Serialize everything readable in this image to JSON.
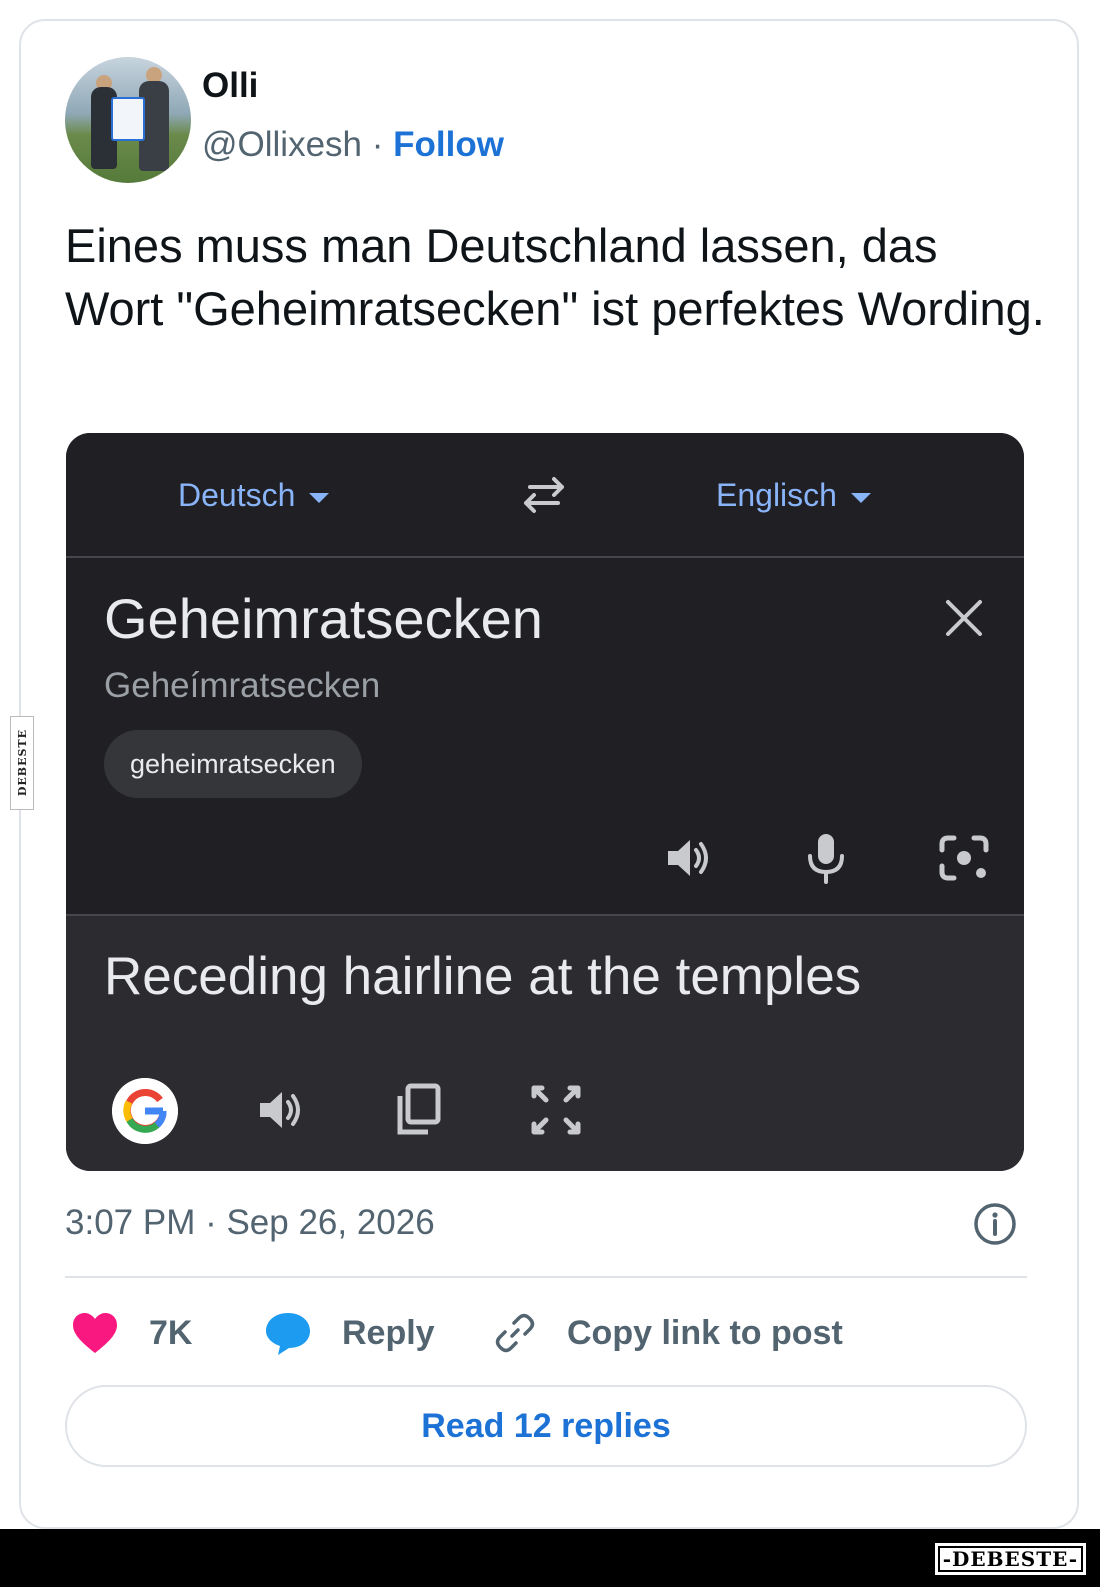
{
  "tweet": {
    "author_name": "Olli",
    "handle": "@Ollixesh",
    "separator": " · ",
    "follow_label": "Follow",
    "text": "Eines muss man Deutschland lassen, das Wort \"Geheimratsecken\" ist perfektes Wording.",
    "timestamp": "3:07 PM · Sep 26, 2026"
  },
  "translate": {
    "source_lang": "Deutsch",
    "target_lang": "Englisch",
    "source_text": "Geheimratsecken",
    "transliteration": "Geheímratsecken",
    "suggestion_chip": "geheimratsecken",
    "translation": "Receding hairline at the temples",
    "icons": [
      "swap-languages-icon",
      "close-icon",
      "speaker-icon",
      "microphone-icon",
      "camera-lens-icon",
      "google-logo",
      "copy-icon",
      "fullscreen-icon"
    ]
  },
  "actions": {
    "like_count": "7K",
    "reply_label": "Reply",
    "copy_link_label": "Copy link to post",
    "read_replies_label": "Read 12 replies"
  },
  "watermark": {
    "side_text": "DEBESTE",
    "footer_text": "-DEBESTE-"
  },
  "colors": {
    "accent": "#1d72d6",
    "like": "#f91880",
    "reply_bubble": "#1d9bf0",
    "translate_link": "#8ab4f8"
  }
}
